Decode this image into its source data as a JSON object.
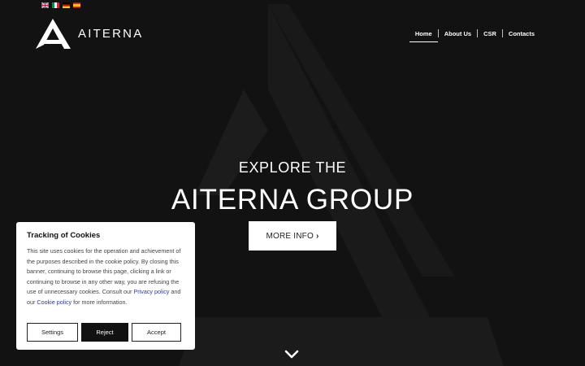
{
  "header": {
    "languages": [
      {
        "code": "en",
        "icon": "uk-flag-icon"
      },
      {
        "code": "it",
        "icon": "italy-flag-icon"
      },
      {
        "code": "de",
        "icon": "germany-flag-icon"
      },
      {
        "code": "es",
        "icon": "spain-flag-icon"
      }
    ],
    "logo_text": "AITERNA",
    "nav": [
      {
        "label": "Home",
        "active": true
      },
      {
        "label": "About Us",
        "active": false
      },
      {
        "label": "CSR",
        "active": false
      },
      {
        "label": "Contacts",
        "active": false
      }
    ]
  },
  "hero": {
    "line1": "EXPLORE THE",
    "line2": "AITERNA GROUP",
    "button_label": "MORE INFO",
    "button_icon": "chevron-right-icon",
    "scroll_icon": "chevron-down-icon"
  },
  "cookie_banner": {
    "title": "Tracking of Cookies",
    "text_before_privacy": "This site uses cookies for the operation and achievement of the purposes described in the cookie policy. By closing this banner, continuing to browse this page, clicking a link or continuing to browse in any other way, you are refusing the use of unnecessary cookies. Consult our ",
    "privacy_link": "Privacy policy",
    "text_between": " and our ",
    "cookie_link": "Cookie policy",
    "text_after": " for more information.",
    "settings_label": "Settings",
    "reject_label": "Reject",
    "accept_label": "Accept"
  },
  "colors": {
    "background": "#121212",
    "link": "#2b3a9c",
    "button_dark": "#111111"
  }
}
